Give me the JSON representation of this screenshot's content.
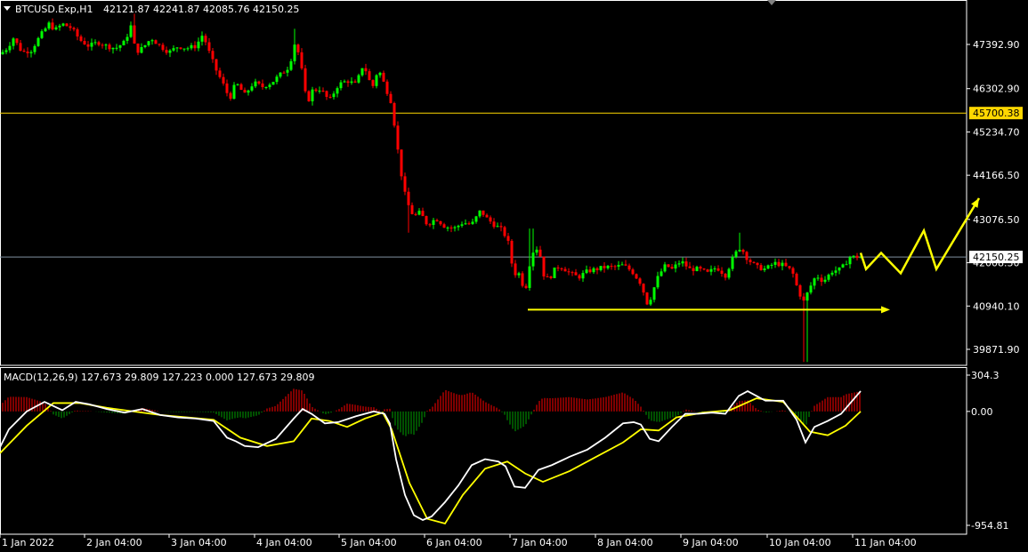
{
  "header": {
    "symbol": "BTCUSD.Exp,H1",
    "ohlc": "42121.87 42241.87 42085.76 42150.25"
  },
  "colors": {
    "background": "#000000",
    "bull": "#00ff00",
    "bear": "#ff0000",
    "frame": "#ffffff",
    "level_line": "#ffd700",
    "arrow": "#ffff00",
    "macd_main": "#ffffff",
    "macd_signal": "#ffff00",
    "hist_pos": "#ff0000",
    "hist_neg": "#00a000"
  },
  "chart_data": [
    {
      "type": "candlestick",
      "title": "BTCUSD.Exp,H1",
      "ylim": [
        39460,
        48240
      ],
      "price_ticks": [
        "47392.90",
        "46302.90",
        "45234.70",
        "44166.50",
        "43076.50",
        "42008.30",
        "40940.10",
        "39871.90"
      ],
      "x_ticks": [
        "1 Jan 2022",
        "2 Jan 04:00",
        "3 Jan 04:00",
        "4 Jan 04:00",
        "5 Jan 04:00",
        "6 Jan 04:00",
        "7 Jan 04:00",
        "8 Jan 04:00",
        "9 Jan 04:00",
        "10 Jan 04:00",
        "11 Jan 04:00"
      ],
      "resistance_level": {
        "value": 45700.38,
        "label": "45700.38"
      },
      "current_price": {
        "value": 42150.25,
        "label": "42150.25"
      },
      "close_path": [
        [
          0,
          47150
        ],
        [
          8,
          47300
        ],
        [
          15,
          47550
        ],
        [
          25,
          47200
        ],
        [
          35,
          47250
        ],
        [
          45,
          47600
        ],
        [
          55,
          47900
        ],
        [
          62,
          47750
        ],
        [
          70,
          47900
        ],
        [
          80,
          47800
        ],
        [
          90,
          47500
        ],
        [
          100,
          47350
        ],
        [
          110,
          47450
        ],
        [
          120,
          47350
        ],
        [
          130,
          47300
        ],
        [
          140,
          47450
        ],
        [
          148,
          47900
        ],
        [
          152,
          47200
        ],
        [
          160,
          47300
        ],
        [
          170,
          47550
        ],
        [
          180,
          47350
        ],
        [
          190,
          47200
        ],
        [
          200,
          47350
        ],
        [
          210,
          47300
        ],
        [
          220,
          47350
        ],
        [
          228,
          47650
        ],
        [
          235,
          47200
        ],
        [
          242,
          46800
        ],
        [
          250,
          46450
        ],
        [
          258,
          46050
        ],
        [
          265,
          46450
        ],
        [
          275,
          46150
        ],
        [
          285,
          46450
        ],
        [
          295,
          46350
        ],
        [
          305,
          46450
        ],
        [
          315,
          46650
        ],
        [
          325,
          46850
        ],
        [
          332,
          47500
        ],
        [
          338,
          46900
        ],
        [
          345,
          45900
        ],
        [
          350,
          46250
        ],
        [
          360,
          46300
        ],
        [
          370,
          46000
        ],
        [
          380,
          46400
        ],
        [
          390,
          46500
        ],
        [
          400,
          46400
        ],
        [
          408,
          46900
        ],
        [
          412,
          46700
        ],
        [
          418,
          46300
        ],
        [
          425,
          46800
        ],
        [
          432,
          46400
        ],
        [
          440,
          45950
        ],
        [
          445,
          45100
        ],
        [
          450,
          44300
        ],
        [
          455,
          43700
        ],
        [
          460,
          43350
        ],
        [
          465,
          43150
        ],
        [
          472,
          43250
        ],
        [
          480,
          42950
        ],
        [
          490,
          43100
        ],
        [
          500,
          42900
        ],
        [
          510,
          42850
        ],
        [
          520,
          43000
        ],
        [
          530,
          42950
        ],
        [
          540,
          43300
        ],
        [
          547,
          43100
        ],
        [
          555,
          42950
        ],
        [
          565,
          42800
        ],
        [
          572,
          42450
        ],
        [
          577,
          41700
        ],
        [
          582,
          41800
        ],
        [
          590,
          41300
        ],
        [
          597,
          42250
        ],
        [
          605,
          42400
        ],
        [
          612,
          41600
        ],
        [
          618,
          41650
        ],
        [
          625,
          41900
        ],
        [
          632,
          41900
        ],
        [
          640,
          41750
        ],
        [
          650,
          41650
        ],
        [
          660,
          41800
        ],
        [
          670,
          41850
        ],
        [
          680,
          41900
        ],
        [
          690,
          41900
        ],
        [
          700,
          41950
        ],
        [
          710,
          41800
        ],
        [
          720,
          41500
        ],
        [
          728,
          40950
        ],
        [
          735,
          41400
        ],
        [
          740,
          41700
        ],
        [
          748,
          41950
        ],
        [
          755,
          41850
        ],
        [
          765,
          42050
        ],
        [
          775,
          41850
        ],
        [
          785,
          41850
        ],
        [
          795,
          41750
        ],
        [
          805,
          41900
        ],
        [
          815,
          41700
        ],
        [
          825,
          42200
        ],
        [
          832,
          42400
        ],
        [
          840,
          42100
        ],
        [
          850,
          41900
        ],
        [
          860,
          41850
        ],
        [
          870,
          42000
        ],
        [
          880,
          41950
        ],
        [
          890,
          41800
        ],
        [
          897,
          41300
        ],
        [
          903,
          41050
        ],
        [
          910,
          41400
        ],
        [
          917,
          41700
        ],
        [
          925,
          41550
        ],
        [
          935,
          41800
        ],
        [
          945,
          41850
        ],
        [
          955,
          42150
        ],
        [
          962,
          42150
        ],
        [
          967,
          42150
        ]
      ],
      "wick_extremes": [
        {
          "x": 150,
          "high": 48150
        },
        {
          "x": 332,
          "high": 47780
        },
        {
          "x": 597,
          "high": 42850
        },
        {
          "x": 832,
          "high": 42750
        },
        {
          "x": 905,
          "low": 39560
        },
        {
          "x": 458,
          "low": 42750
        }
      ],
      "support_arrow": {
        "from": [
          593,
          40850
        ],
        "to": [
          1000,
          40850
        ]
      },
      "forecast_zigzag": [
        [
          967,
          42250
        ],
        [
          973,
          41850
        ],
        [
          990,
          42250
        ],
        [
          1012,
          41750
        ],
        [
          1038,
          42800
        ],
        [
          1052,
          41850
        ],
        [
          1100,
          43600
        ]
      ]
    },
    {
      "type": "line",
      "title": "MACD(12,26,9) 127.673 29.809 127.223 0.000 127.673 29.809",
      "indicator": "MACD",
      "ylim": [
        -1000,
        360
      ],
      "y_ticks": [
        "304.3",
        "0.00",
        "-954.81"
      ],
      "series": [
        {
          "name": "macd-main",
          "x": [
            0,
            10,
            30,
            50,
            70,
            85,
            100,
            120,
            140,
            160,
            180,
            200,
            220,
            240,
            255,
            265,
            275,
            290,
            310,
            330,
            340,
            350,
            365,
            380,
            400,
            420,
            432,
            438,
            445,
            455,
            465,
            475,
            485,
            500,
            515,
            530,
            545,
            560,
            568,
            578,
            590,
            605,
            620,
            640,
            660,
            680,
            700,
            712,
            720,
            730,
            740,
            755,
            770,
            785,
            800,
            815,
            830,
            840,
            850,
            860,
            880,
            895,
            905,
            915,
            930,
            945,
            960,
            967
          ],
          "values": [
            -300,
            -150,
            0,
            80,
            10,
            80,
            60,
            20,
            -10,
            20,
            -30,
            -50,
            -60,
            -80,
            -220,
            -250,
            -290,
            -300,
            -230,
            -60,
            20,
            -20,
            -100,
            -90,
            -40,
            0,
            -20,
            -100,
            -400,
            -700,
            -870,
            -910,
            -880,
            -760,
            -620,
            -450,
            -400,
            -420,
            -460,
            -630,
            -640,
            -490,
            -450,
            -380,
            -320,
            -220,
            -100,
            -90,
            -110,
            -230,
            -250,
            -130,
            -20,
            -20,
            -10,
            -20,
            130,
            170,
            130,
            90,
            90,
            -70,
            -260,
            -130,
            -80,
            -20,
            110,
            170
          ]
        },
        {
          "name": "macd-signal",
          "x": [
            0,
            30,
            60,
            90,
            120,
            150,
            180,
            210,
            240,
            270,
            300,
            330,
            350,
            370,
            390,
            410,
            430,
            440,
            460,
            480,
            500,
            520,
            545,
            570,
            590,
            610,
            640,
            670,
            700,
            720,
            740,
            760,
            790,
            820,
            850,
            880,
            910,
            930,
            950,
            967
          ],
          "values": [
            -350,
            -120,
            70,
            70,
            30,
            0,
            -30,
            -50,
            -70,
            -220,
            -290,
            -250,
            -60,
            -80,
            -130,
            -60,
            -10,
            -150,
            -600,
            -900,
            -940,
            -700,
            -480,
            -420,
            -520,
            -590,
            -500,
            -380,
            -260,
            -150,
            -160,
            -50,
            -10,
            10,
            110,
            80,
            -170,
            -200,
            -120,
            0
          ]
        }
      ]
    }
  ]
}
